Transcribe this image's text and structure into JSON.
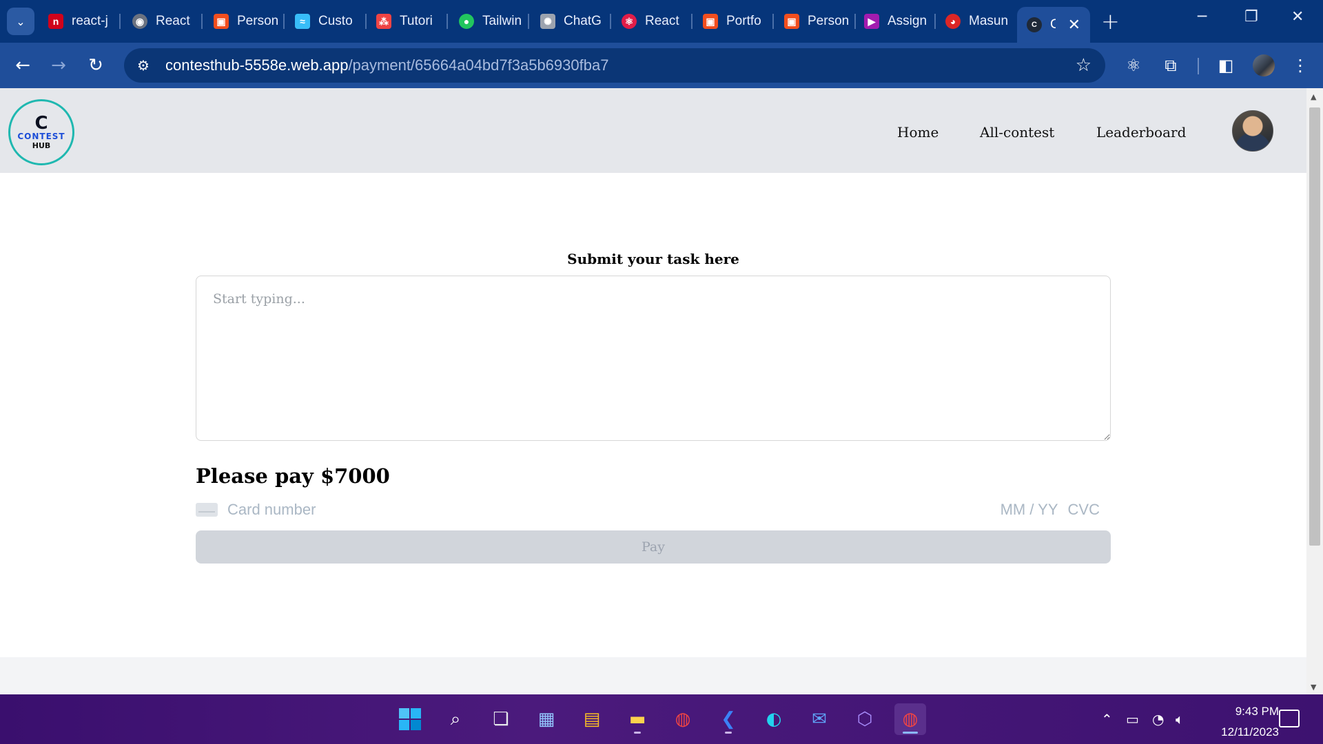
{
  "browser": {
    "tabs": [
      {
        "label": "react-j",
        "color": "#d0021b",
        "glyph": "n"
      },
      {
        "label": "React",
        "color": "#6b7280",
        "glyph": "◉"
      },
      {
        "label": "Person",
        "color": "#f24e1e",
        "glyph": "▣"
      },
      {
        "label": "Custo",
        "color": "#38bdf8",
        "glyph": "≈"
      },
      {
        "label": "Tutori",
        "color": "#ef4444",
        "glyph": "⁂"
      },
      {
        "label": "Tailwin",
        "color": "#22c55e",
        "glyph": "●"
      },
      {
        "label": "ChatG",
        "color": "#9ca3af",
        "glyph": "✺"
      },
      {
        "label": "React",
        "color": "#e11d48",
        "glyph": "⚛"
      },
      {
        "label": "Portfo",
        "color": "#f24e1e",
        "glyph": "▣"
      },
      {
        "label": "Person",
        "color": "#f24e1e",
        "glyph": "▣"
      },
      {
        "label": "Assign",
        "color": "#a21caf",
        "glyph": "▶"
      },
      {
        "label": "Masun",
        "color": "#dc2626",
        "glyph": "◕"
      }
    ],
    "active_tab": {
      "label": "C",
      "close": "✕"
    },
    "new_tab": "+",
    "url_host": "contesthub-5558e.web.app",
    "url_path": "/payment/65664a04bd7f3a5b6930fba7"
  },
  "site": {
    "logo_c": "C",
    "logo_line1": "CONTEST",
    "logo_line2": "HUB",
    "nav": [
      "Home",
      "All-contest",
      "Leaderboard"
    ]
  },
  "form": {
    "task_label": "Submit your task here",
    "task_placeholder": "Start typing...",
    "pay_title": "Please pay $7000",
    "card_placeholder": "Card number",
    "card_expiry": "MM / YY",
    "card_cvc": "CVC",
    "pay_button": "Pay"
  },
  "taskbar": {
    "time": "9:43 PM",
    "date": "12/11/2023"
  }
}
